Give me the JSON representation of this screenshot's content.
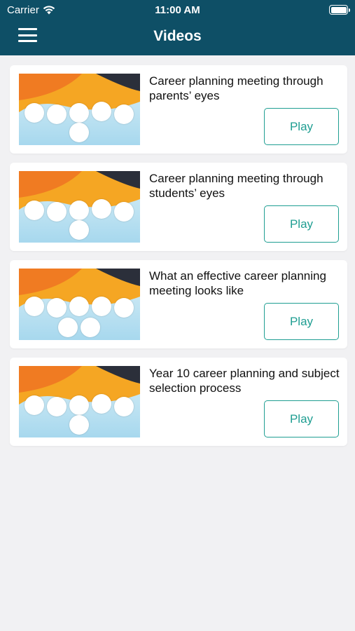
{
  "status_bar": {
    "carrier": "Carrier",
    "time": "11:00 AM"
  },
  "nav": {
    "title": "Videos",
    "menu_icon": "hamburger-menu-icon"
  },
  "videos": [
    {
      "title": "Career planning meeting through parents’ eyes",
      "play_label": "Play"
    },
    {
      "title": "Career planning meeting through students’ eyes",
      "play_label": "Play"
    },
    {
      "title": "What an effective career planning meeting looks like",
      "play_label": "Play"
    },
    {
      "title": "Year 10 career planning and subject selection process",
      "play_label": "Play"
    }
  ],
  "colors": {
    "nav_bg": "#0e4f66",
    "accent": "#1f9e92",
    "page_bg": "#f1f1f3"
  }
}
